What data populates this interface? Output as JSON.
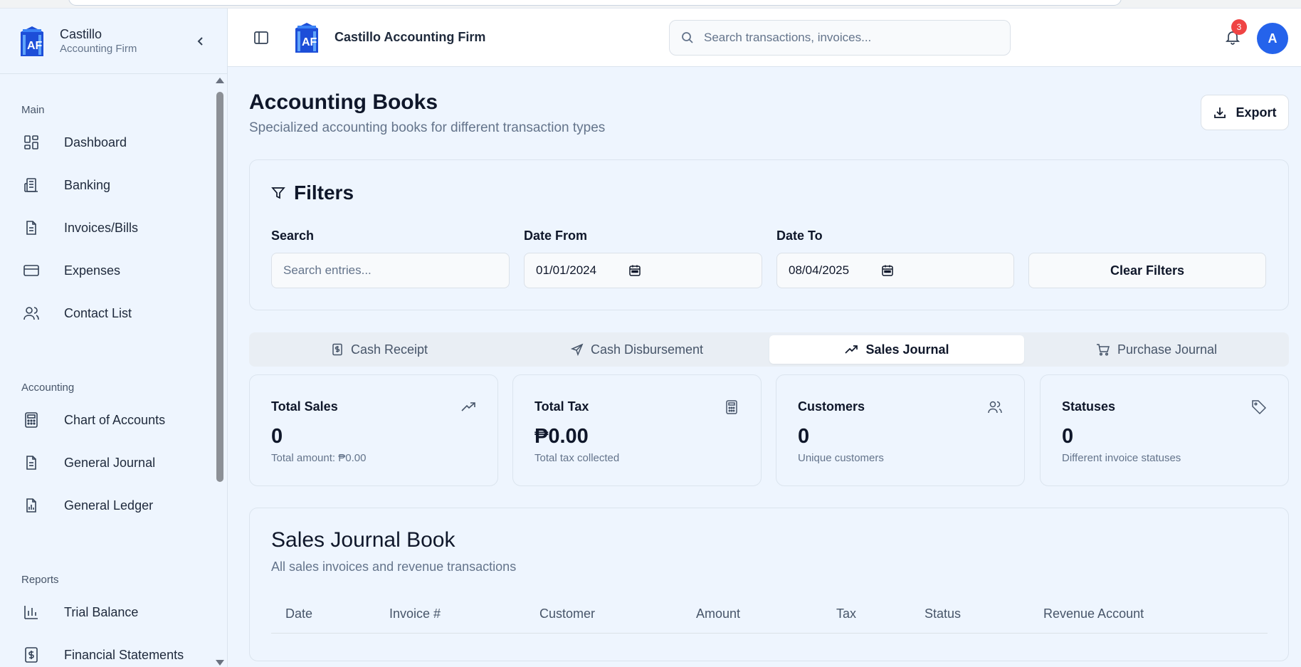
{
  "app": {
    "brand_name": "Castillo",
    "brand_sub": "Accounting Firm",
    "header_title": "Castillo Accounting Firm",
    "search_placeholder": "Search transactions, invoices...",
    "notification_count": "3",
    "avatar_initial": "A",
    "accent_color": "#2563eb"
  },
  "sidebar": {
    "sections": [
      {
        "title": "Main",
        "items": [
          {
            "label": "Dashboard",
            "icon": "dashboard-grid-icon"
          },
          {
            "label": "Banking",
            "icon": "bank-building-icon"
          },
          {
            "label": "Invoices/Bills",
            "icon": "document-icon"
          },
          {
            "label": "Expenses",
            "icon": "credit-card-icon"
          },
          {
            "label": "Contact List",
            "icon": "users-icon"
          }
        ]
      },
      {
        "title": "Accounting",
        "items": [
          {
            "label": "Chart of Accounts",
            "icon": "calculator-icon"
          },
          {
            "label": "General Journal",
            "icon": "document-icon"
          },
          {
            "label": "General Ledger",
            "icon": "file-chart-icon"
          }
        ]
      },
      {
        "title": "Reports",
        "items": [
          {
            "label": "Trial Balance",
            "icon": "bar-chart-icon"
          },
          {
            "label": "Financial Statements",
            "icon": "dollar-receipt-icon"
          }
        ]
      }
    ]
  },
  "page": {
    "title": "Accounting Books",
    "subtitle": "Specialized accounting books for different transaction types",
    "export_label": "Export"
  },
  "filters": {
    "title": "Filters",
    "search_label": "Search",
    "search_placeholder": "Search entries...",
    "date_from_label": "Date From",
    "date_from_value": "01/01/2024",
    "date_to_label": "Date To",
    "date_to_value": "08/04/2025",
    "clear_label": "Clear Filters"
  },
  "tabs": [
    {
      "label": "Cash Receipt",
      "active": false
    },
    {
      "label": "Cash Disbursement",
      "active": false
    },
    {
      "label": "Sales Journal",
      "active": true
    },
    {
      "label": "Purchase Journal",
      "active": false
    }
  ],
  "stats": [
    {
      "title": "Total Sales",
      "value": "0",
      "note": "Total amount: ₱0.00",
      "icon": "trending-up-icon"
    },
    {
      "title": "Total Tax",
      "value": "₱0.00",
      "note": "Total tax collected",
      "icon": "calculator-icon"
    },
    {
      "title": "Customers",
      "value": "0",
      "note": "Unique customers",
      "icon": "users-icon"
    },
    {
      "title": "Statuses",
      "value": "0",
      "note": "Different invoice statuses",
      "icon": "tag-icon"
    }
  ],
  "journal": {
    "title": "Sales Journal Book",
    "subtitle": "All sales invoices and revenue transactions",
    "columns": [
      "Date",
      "Invoice #",
      "Customer",
      "Amount",
      "Tax",
      "Status",
      "Revenue Account"
    ]
  }
}
